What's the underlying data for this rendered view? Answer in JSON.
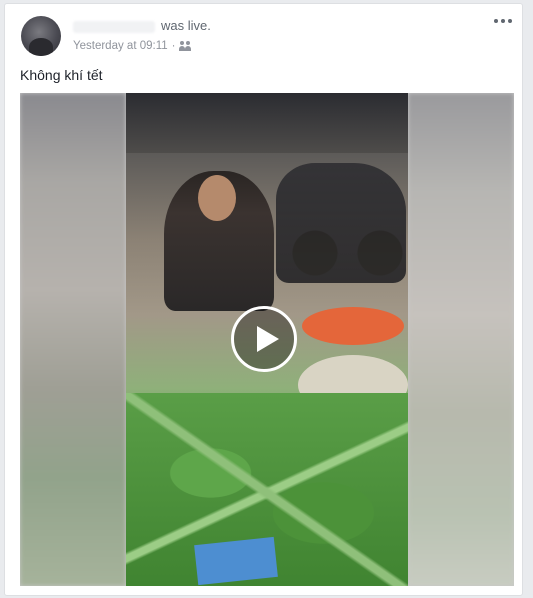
{
  "post": {
    "status": "was live.",
    "timestamp": "Yesterday at 09:11",
    "audience_icon": "friends-icon",
    "text": "Không khí tết",
    "more_icon": "more-options-icon"
  },
  "video": {
    "play_icon": "play-icon"
  }
}
